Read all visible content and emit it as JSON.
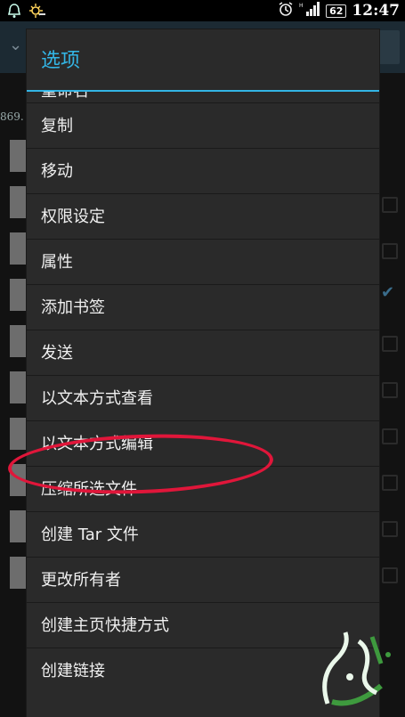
{
  "status_bar": {
    "time": "12:47",
    "battery": "62",
    "icons": [
      "notification-bell-icon",
      "weather-sun-icon",
      "alarm-icon",
      "signal-icon"
    ]
  },
  "background": {
    "path_fragment": "869."
  },
  "dialog": {
    "title": "选项",
    "accent_color": "#33b5e5",
    "partial_item": "重命名",
    "items": [
      "复制",
      "移动",
      "权限设定",
      "属性",
      "添加书签",
      "发送",
      "以文本方式查看",
      "以文本方式编辑",
      "压缩所选文件",
      "创建 Tar 文件",
      "更改所有者",
      "创建主页快捷方式",
      "创建链接"
    ]
  },
  "annotation": {
    "highlight_color": "#e0163a",
    "highlighted_item": "以文本方式编辑"
  }
}
